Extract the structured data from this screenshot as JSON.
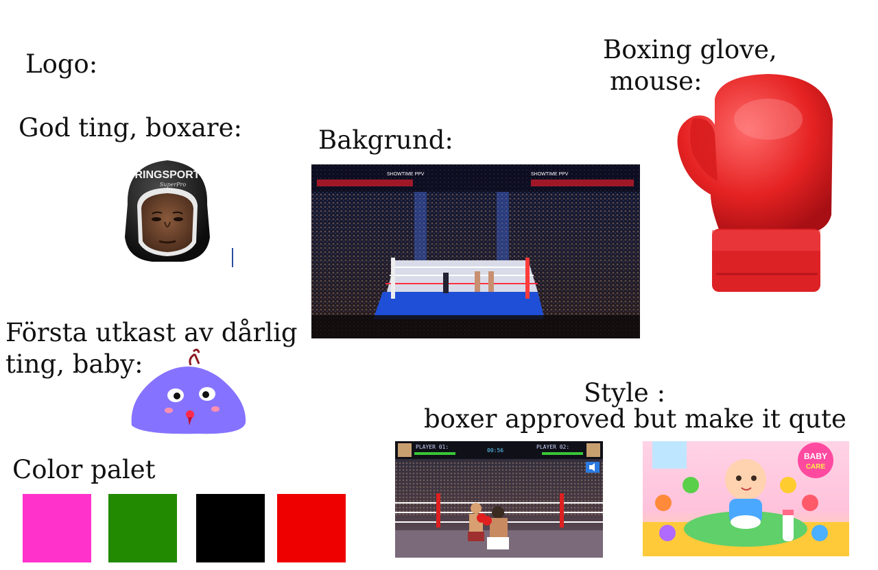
{
  "labels": {
    "logo": "Logo:",
    "good_thing": "God ting, boxare:",
    "background": "Bakgrund:",
    "glove_line1": "Boxing glove,",
    "glove_line2": "mouse:",
    "bad_line1": "Första utkast av dårlig",
    "bad_line2": "ting,  baby:",
    "palette": "Color palet",
    "style_line1": "Style :",
    "style_line2": "boxer approved but make it qute"
  },
  "helmet": {
    "brand": "RINGSPORT",
    "script": "SuperPro"
  },
  "arena": {
    "banner": "SHOWTIME PPV"
  },
  "palette_colors": [
    "#ff33cc",
    "#228a00",
    "#000000",
    "#ee0000"
  ],
  "game_ref": {
    "player1": "PLAYER 01:",
    "player2": "PLAYER 02:",
    "timer": "00:56"
  },
  "baby_ref": {
    "logo_line1": "BABY",
    "logo_line2": "CARE"
  },
  "icons": {
    "helmet": "boxer-helmet-image",
    "arena": "arena-photo",
    "glove": "boxing-glove-image",
    "blob": "baby-blob-drawing",
    "sound": "speaker-icon"
  }
}
